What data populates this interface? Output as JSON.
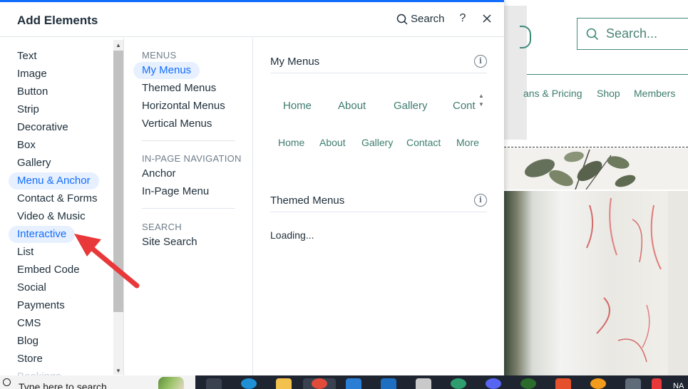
{
  "panel": {
    "title": "Add Elements",
    "search_label": "Search",
    "help_label": "?"
  },
  "categories": [
    {
      "label": "Text",
      "state": "normal"
    },
    {
      "label": "Image",
      "state": "normal"
    },
    {
      "label": "Button",
      "state": "normal"
    },
    {
      "label": "Strip",
      "state": "normal"
    },
    {
      "label": "Decorative",
      "state": "normal"
    },
    {
      "label": "Box",
      "state": "normal"
    },
    {
      "label": "Gallery",
      "state": "normal"
    },
    {
      "label": "Menu & Anchor",
      "state": "active"
    },
    {
      "label": "Contact & Forms",
      "state": "normal"
    },
    {
      "label": "Video & Music",
      "state": "normal"
    },
    {
      "label": "Interactive",
      "state": "hover"
    },
    {
      "label": "List",
      "state": "normal"
    },
    {
      "label": "Embed Code",
      "state": "normal"
    },
    {
      "label": "Social",
      "state": "normal"
    },
    {
      "label": "Payments",
      "state": "normal"
    },
    {
      "label": "CMS",
      "state": "normal"
    },
    {
      "label": "Blog",
      "state": "normal"
    },
    {
      "label": "Store",
      "state": "normal"
    },
    {
      "label": "Bookings",
      "state": "faded"
    }
  ],
  "subcategories": {
    "menus": {
      "heading": "MENUS",
      "items": [
        "My Menus",
        "Themed Menus",
        "Horizontal Menus",
        "Vertical Menus"
      ]
    },
    "in_page": {
      "heading": "IN-PAGE NAVIGATION",
      "items": [
        "Anchor",
        "In-Page Menu"
      ]
    },
    "search": {
      "heading": "SEARCH",
      "items": [
        "Site Search"
      ]
    }
  },
  "content": {
    "my_menus_title": "My Menus",
    "menu_preview_1": [
      "Home",
      "About",
      "Gallery",
      "Cont"
    ],
    "menu_preview_2": [
      "Home",
      "About",
      "Gallery",
      "Contact",
      "More"
    ],
    "themed_menus_title": "Themed Menus",
    "loading_text": "Loading...",
    "info_glyph": "i"
  },
  "site_preview": {
    "search_placeholder": "Search...",
    "nav_items": [
      "ans & Pricing",
      "Shop",
      "Members"
    ],
    "accent_color": "#3d8a7a"
  },
  "taskbar": {
    "search_text": "Type here to search",
    "tray_text": "NA"
  },
  "colors": {
    "active_bg": "#e7f0ff",
    "active_text": "#116dff",
    "arrow": "#e8383a"
  }
}
